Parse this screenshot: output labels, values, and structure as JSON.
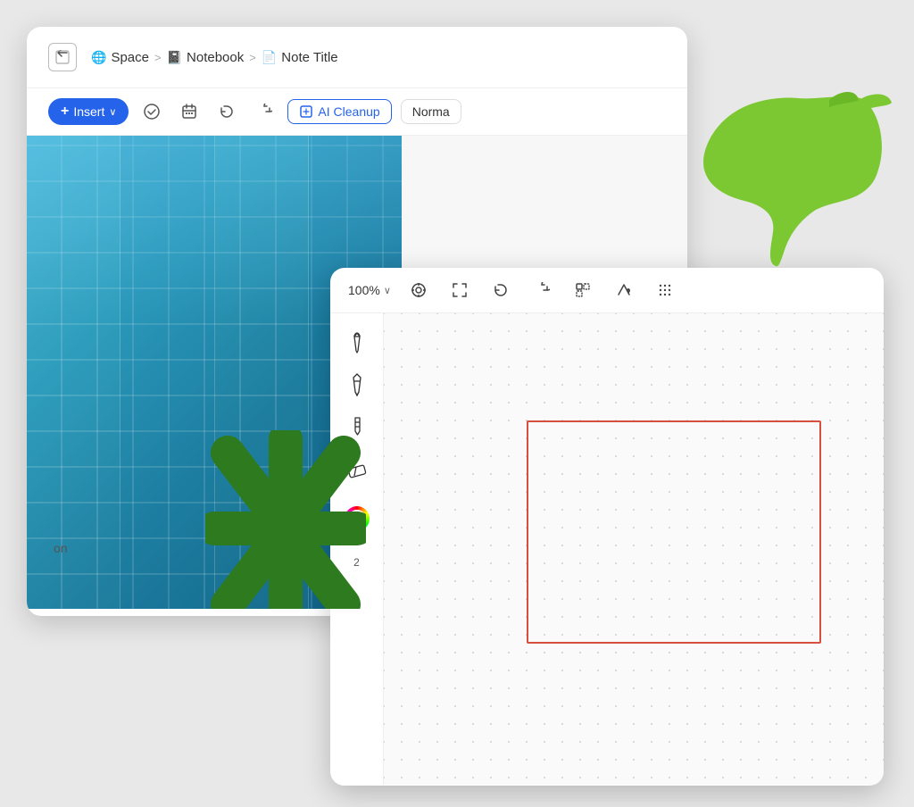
{
  "breadcrumb": {
    "space_label": "Space",
    "notebook_label": "Notebook",
    "note_label": "Note Title",
    "separator": ">"
  },
  "toolbar": {
    "insert_label": "Insert",
    "insert_chevron": "∨",
    "ai_cleanup_label": "AI Cleanup",
    "normal_label": "Norma",
    "undo_icon": "↩",
    "redo_icon": "↪"
  },
  "drawing_toolbar": {
    "zoom_level": "100%",
    "zoom_chevron": "∨"
  },
  "tools": [
    {
      "name": "pen",
      "icon": "✒"
    },
    {
      "name": "marker",
      "icon": "✏"
    },
    {
      "name": "highlighter",
      "icon": "✎"
    },
    {
      "name": "eraser",
      "icon": "⌫"
    },
    {
      "name": "color",
      "icon": "color"
    },
    {
      "name": "layer_count",
      "value": "2"
    }
  ],
  "content": {
    "text_snippet": "on"
  },
  "colors": {
    "insert_btn": "#2563eb",
    "ai_cleanup_border": "#2563eb",
    "rectangle_stroke": "#d94f3d",
    "building_primary": "#4db8d4",
    "green_accent": "#4a9b2f"
  }
}
